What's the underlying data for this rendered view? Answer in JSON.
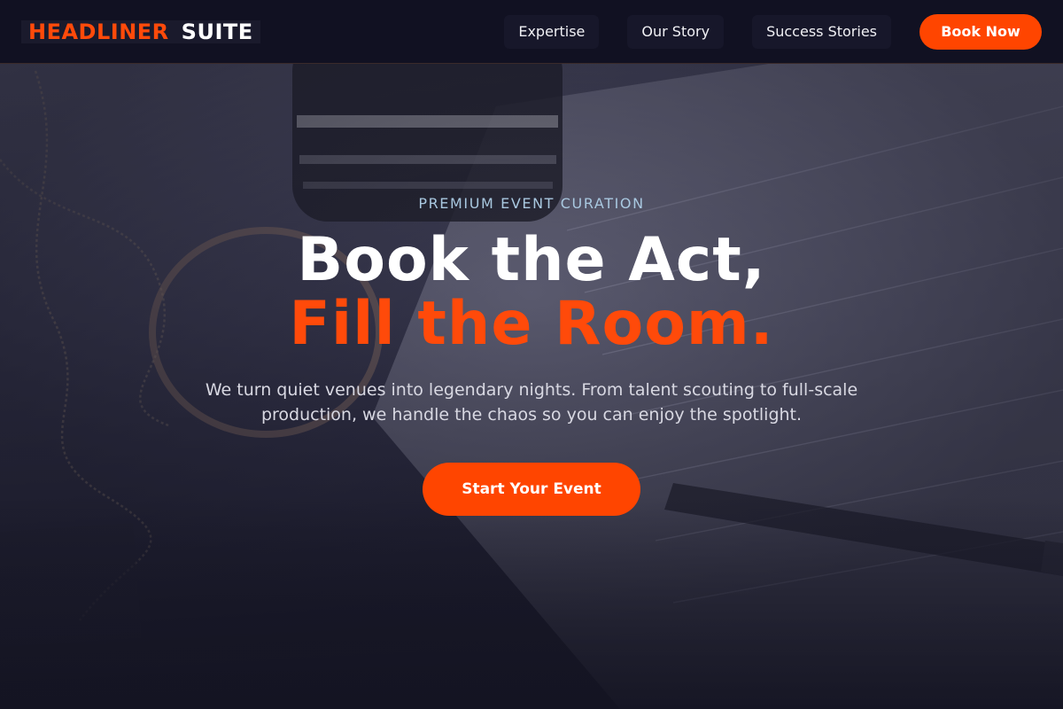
{
  "nav": {
    "logo_accent": "HEADLINER",
    "logo_main": "SUITE",
    "links": [
      {
        "label": "Expertise"
      },
      {
        "label": "Our Story"
      },
      {
        "label": "Success Stories"
      }
    ],
    "cta_label": "Book Now"
  },
  "hero": {
    "eyebrow": "PREMIUM EVENT CURATION",
    "headline_line1": "Book the Act,",
    "headline_line2": "Fill the Room.",
    "subtitle": "We turn quiet venues into legendary nights. From talent scouting to full-scale production, we handle the chaos so you can enjoy the spotlight.",
    "cta_label": "Start Your Event",
    "background_image": "desk-flatlay-photo"
  },
  "colors": {
    "accent": "#ff4500",
    "nav_bg": "#111122",
    "eyebrow": "#a9c8e0",
    "subtitle": "#d8d8e2"
  }
}
